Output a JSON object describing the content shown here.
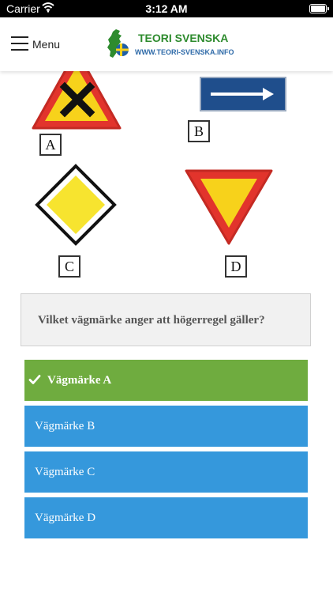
{
  "status": {
    "carrier": "Carrier",
    "time": "3:12 AM"
  },
  "header": {
    "menu_label": "Menu",
    "logo_title": "TEORI SVENSKA",
    "logo_url": "WWW.TEORI-SVENSKA.INFO"
  },
  "signs": {
    "labels": [
      "A",
      "B",
      "C",
      "D"
    ]
  },
  "question": {
    "text": "Vilket vägmärke anger att högerregel gäller?"
  },
  "answers": [
    {
      "label": "Vägmärke A",
      "state": "correct"
    },
    {
      "label": "Vägmärke B",
      "state": "normal"
    },
    {
      "label": "Vägmärke C",
      "state": "normal"
    },
    {
      "label": "Vägmärke D",
      "state": "normal"
    }
  ],
  "colors": {
    "correct": "#6fac3f",
    "answer": "#3598dc",
    "question_bg": "#f1f1f1",
    "sign_yellow": "#f7d21b",
    "sign_red": "#e2342c",
    "sign_blue": "#1f4e8c"
  },
  "icons": {
    "menu": "hamburger-icon",
    "wifi": "wifi-icon",
    "battery": "battery-icon",
    "correct": "check-icon"
  }
}
